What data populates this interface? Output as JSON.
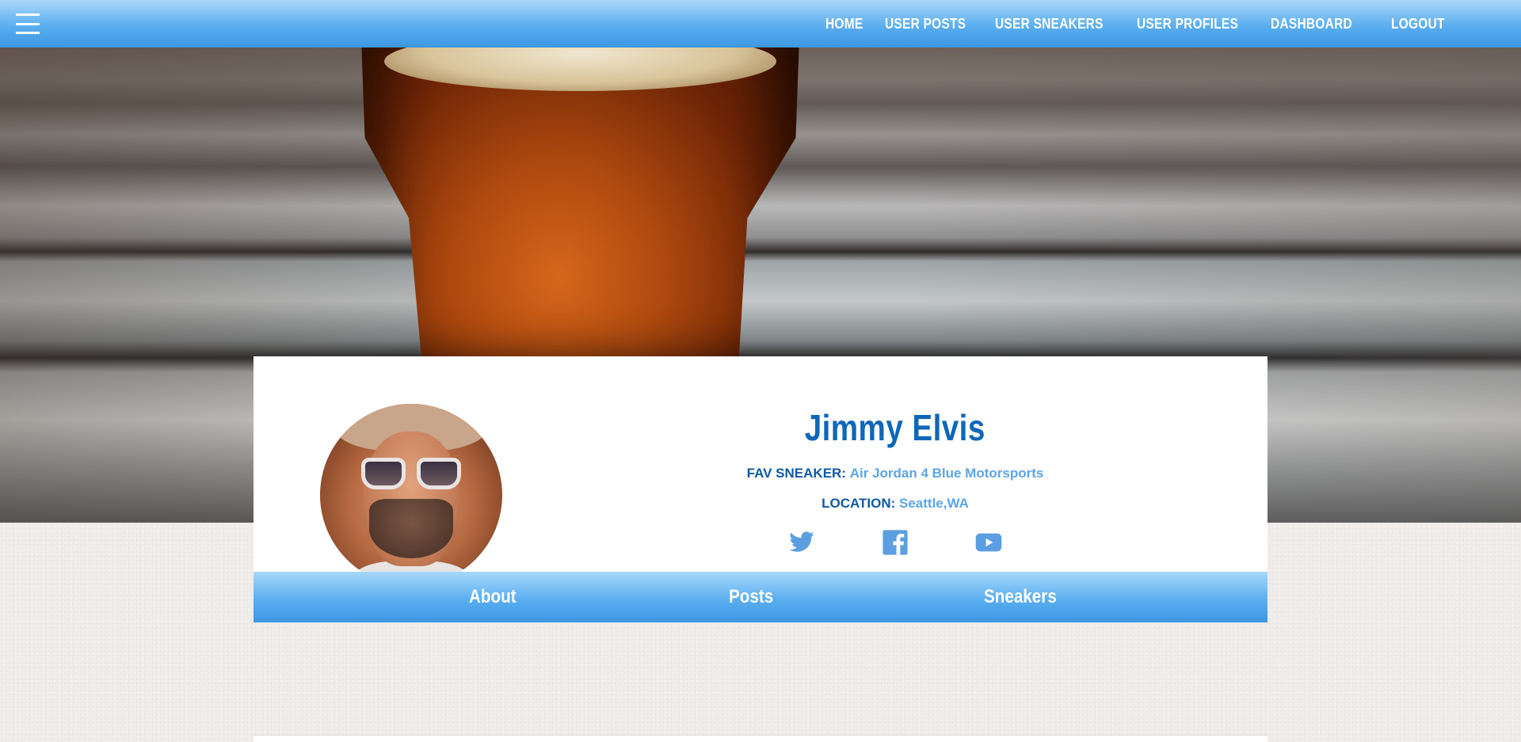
{
  "nav": {
    "menu_icon": "hamburger-menu-icon",
    "links": [
      "HOME",
      "USER POSTS",
      "USER SNEAKERS",
      "USER PROFILES",
      "DASHBOARD"
    ],
    "logout": "LOGOUT"
  },
  "profile": {
    "name": "Jimmy Elvis",
    "fav_sneaker_label": "FAV SNEAKER:",
    "fav_sneaker_value": "Air Jordan 4 Blue Motorsports",
    "location_label": "LOCATION:",
    "location_value": "Seattle,WA",
    "social_icons": [
      "twitter-icon",
      "facebook-icon",
      "youtube-icon"
    ]
  },
  "tabs": [
    "About",
    "Posts",
    "Sneakers"
  ],
  "colors": {
    "nav_blue_top": "#a9d8fb",
    "nav_blue_bottom": "#3d97e2",
    "name_blue": "#0f67b8",
    "value_blue": "#5ea5e6",
    "icon_blue": "#5b9fe0"
  }
}
